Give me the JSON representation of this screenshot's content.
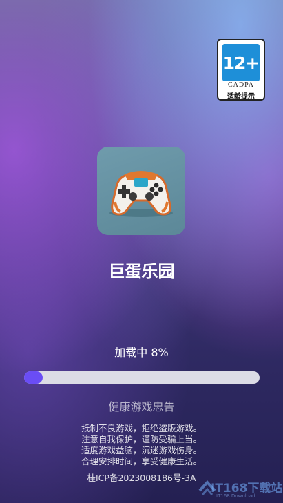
{
  "age_badge": {
    "rating": "12+",
    "org": "CADPA",
    "label": "适龄提示"
  },
  "app": {
    "name": "巨蛋乐园",
    "icon": "gamepad-icon"
  },
  "loading": {
    "text": "加载中 8%",
    "progress": 0.08,
    "accent_color": "#6a4df5"
  },
  "slogan": "健康游戏忠告",
  "notice_lines": [
    "抵制不良游戏，拒绝盗版游戏。",
    "注意自我保护，谨防受骗上当。",
    "适度游戏益脑，沉迷游戏伤身。",
    "合理安排时间，享受健康生活。"
  ],
  "icp": "桂ICP备2023008186号-3A",
  "watermark": {
    "text": "IT168下载站",
    "sub": "IT168 Download"
  }
}
